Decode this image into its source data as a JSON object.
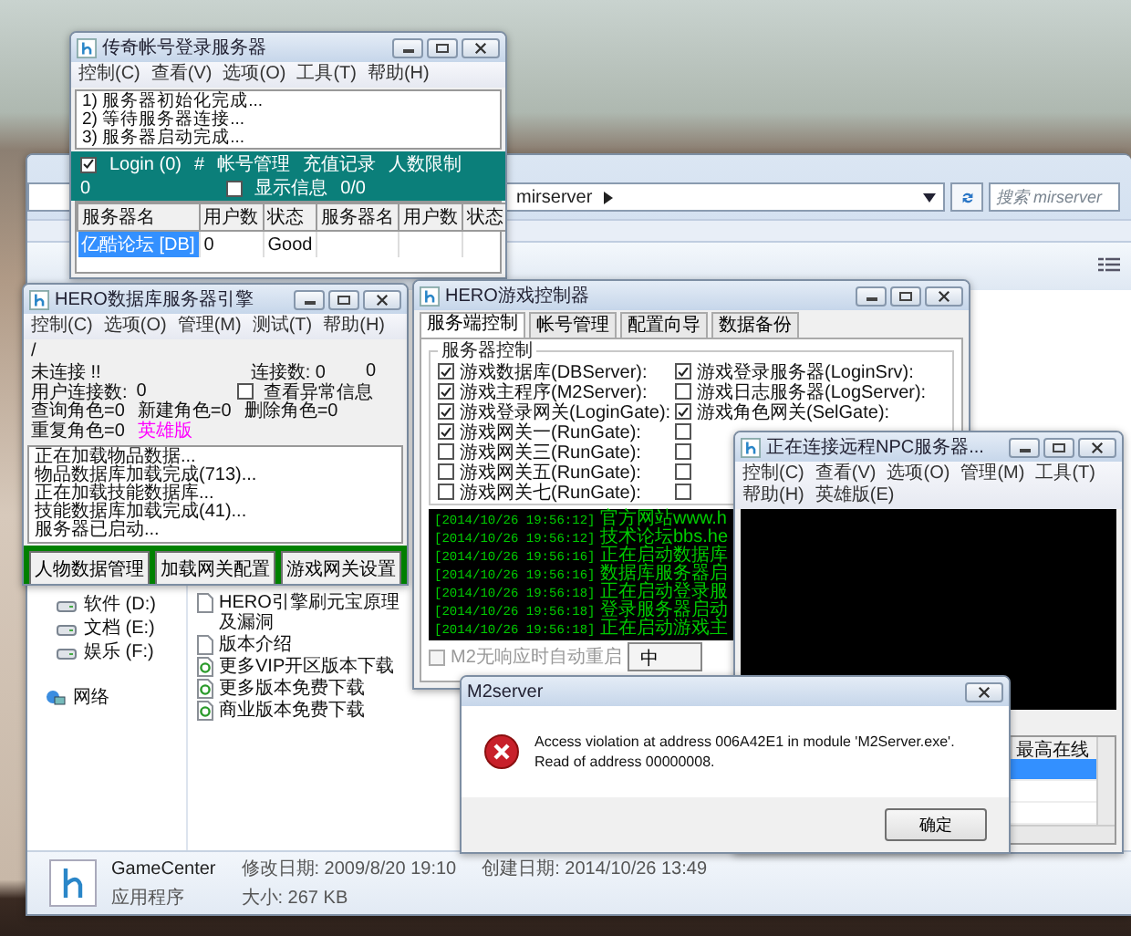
{
  "explorer": {
    "address": "mirserver",
    "search": {
      "placeholder": "搜索 mirserver"
    },
    "nav_items": [
      {
        "label": "软件 (D:)",
        "kind": "drive"
      },
      {
        "label": "文档 (E:)",
        "kind": "drive"
      },
      {
        "label": "娱乐 (F:)",
        "kind": "drive"
      },
      {
        "label": "网络",
        "kind": "network"
      }
    ],
    "files": [
      {
        "name": "HERO引擎刷元宝原理及漏洞",
        "kind": "document"
      },
      {
        "name": "版本介绍",
        "kind": "document"
      },
      {
        "name": "更多VIP开区版本下载",
        "kind": "web-link"
      },
      {
        "name": "更多版本免费下载",
        "kind": "web-link"
      },
      {
        "name": "商业版本免费下载",
        "kind": "web-link"
      }
    ],
    "details": {
      "name": "GameCenter",
      "modified": "修改日期: 2009/8/20 19:10",
      "created": "创建日期: 2014/10/26 13:49",
      "type": "应用程序",
      "size": "大小: 267 KB"
    }
  },
  "login_server": {
    "title": "传奇帐号登录服务器",
    "menu": [
      "控制(C)",
      "查看(V)",
      "选项(O)",
      "工具(T)",
      "帮助(H)"
    ],
    "log": [
      "1) 服务器初始化完成...",
      "2) 等待服务器连接...",
      "3) 服务器启动完成..."
    ],
    "login_check": {
      "label": "Login (0)",
      "checked": true
    },
    "hash": "#",
    "links": [
      "帐号管理",
      "充值记录",
      "人数限制"
    ],
    "count": "0",
    "show_info": {
      "label": "显示信息",
      "checked": false
    },
    "ratio": "0/0",
    "table": {
      "columns": [
        "服务器名",
        "用户数",
        "状态",
        "服务器名",
        "用户数",
        "状态"
      ],
      "rows": [
        {
          "cells": [
            "亿酷论坛 [DB]",
            "0",
            "Good"
          ],
          "selected": true
        }
      ]
    }
  },
  "db_server": {
    "title": "HERO数据库服务器引擎",
    "menu": [
      "控制(C)",
      "选项(O)",
      "管理(M)",
      "测试(T)",
      "帮助(H)"
    ],
    "path": "/",
    "status": "未连接 !!",
    "connections": "连接数: 0",
    "connections_extra": "0",
    "user_connections": "用户连接数:",
    "user_connections_value": "0",
    "show_errors": {
      "label": "查看异常信息",
      "checked": false
    },
    "stats": [
      "查询角色=0",
      "新建角色=0",
      "删除角色=0",
      "重复角色=0"
    ],
    "edition": "英雄版",
    "log": [
      "正在加载物品数据...",
      "物品数据库加载完成(713)...",
      "正在加载技能数据库...",
      "技能数据库加载完成(41)...",
      "服务器已启动..."
    ],
    "buttons": [
      "人物数据管理",
      "加载网关配置",
      "游戏网关设置"
    ]
  },
  "controller": {
    "title": "HERO游戏控制器",
    "tabs": [
      {
        "label": "服务端控制",
        "selected": true
      },
      {
        "label": "帐号管理",
        "selected": false
      },
      {
        "label": "配置向导",
        "selected": false
      },
      {
        "label": "数据备份",
        "selected": false
      }
    ],
    "group_title": "服务器控制",
    "left_items": [
      {
        "label": "游戏数据库(DBServer):",
        "checked": true
      },
      {
        "label": "游戏主程序(M2Server):",
        "checked": true
      },
      {
        "label": "游戏登录网关(LoginGate):",
        "checked": true
      },
      {
        "label": "游戏网关一(RunGate):",
        "checked": true
      },
      {
        "label": "游戏网关三(RunGate):",
        "checked": false
      },
      {
        "label": "游戏网关五(RunGate):",
        "checked": false
      },
      {
        "label": "游戏网关七(RunGate):",
        "checked": false
      }
    ],
    "right_items": [
      {
        "label": "游戏登录服务器(LoginSrv):",
        "checked": true
      },
      {
        "label": "游戏日志服务器(LogServer):",
        "checked": false
      },
      {
        "label": "游戏角色网关(SelGate):",
        "checked": true
      },
      {
        "checked": false
      },
      {
        "checked": false
      },
      {
        "checked": false
      },
      {
        "checked": false
      }
    ],
    "log": [
      {
        "time": "[2014/10/26 19:56:12]",
        "message": "官方网站www.h"
      },
      {
        "time": "[2014/10/26 19:56:12]",
        "message": "技术论坛bbs.he"
      },
      {
        "time": "[2014/10/26 19:56:16]",
        "message": "正在启动数据库"
      },
      {
        "time": "[2014/10/26 19:56:16]",
        "message": "数据库服务器启"
      },
      {
        "time": "[2014/10/26 19:56:18]",
        "message": "正在启动登录服"
      },
      {
        "time": "[2014/10/26 19:56:18]",
        "message": "登录服务器启动"
      },
      {
        "time": "[2014/10/26 19:56:18]",
        "message": "正在启动游戏主"
      }
    ],
    "auto_restart": {
      "label": "M2无响应时自动重启",
      "checked": false,
      "disabled": true
    },
    "button": "中"
  },
  "npc_server": {
    "title": "正在连接远程NPC服务器...",
    "menu": [
      "控制(C)",
      "查看(V)",
      "选项(O)",
      "管理(M)",
      "工具(T)",
      "帮助(H)",
      "英雄版(E)"
    ],
    "table": {
      "column": "最高在线",
      "rows": [
        {
          "selected": true
        },
        {
          "selected": false
        },
        {
          "selected": false
        }
      ]
    }
  },
  "error_dialog": {
    "title": "M2server",
    "message": [
      "Access violation at address 006A42E1 in module 'M2Server.exe'.",
      "Read of address 00000008."
    ],
    "button": "确定"
  }
}
